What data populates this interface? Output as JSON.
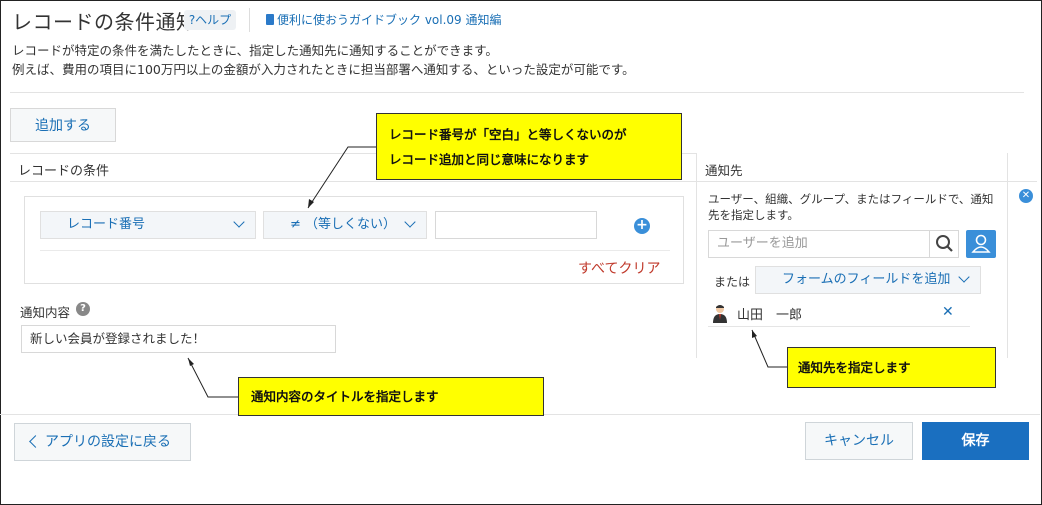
{
  "header": {
    "title": "レコードの条件通知",
    "help_label": "?ヘルプ",
    "guide_link": "便利に使おうガイドブック vol.09 通知編"
  },
  "description": {
    "line1": "レコードが特定の条件を満たしたときに、指定した通知先に通知することができます。",
    "line2": "例えば、費用の項目に100万円以上の金額が入力されたときに担当部署へ通知する、といった設定が可能です。"
  },
  "toolbar": {
    "add_label": "追加する"
  },
  "condition": {
    "header": "レコードの条件",
    "field_select": "レコード番号",
    "operator_select": "≠ （等しくない）",
    "value": "",
    "clear_all": "すべてクリア"
  },
  "notification": {
    "content_label": "通知内容",
    "content_value": "新しい会員が登録されました！"
  },
  "recipients": {
    "header": "通知先",
    "description": "ユーザー、組織、グループ、またはフィールドで、通知先を指定します。",
    "user_placeholder": "ユーザーを追加",
    "or_label": "または",
    "form_field_select": "フォームのフィールドを追加",
    "users": [
      "山田　一郎"
    ]
  },
  "footer": {
    "back_label": "アプリの設定に戻る",
    "cancel_label": "キャンセル",
    "save_label": "保存"
  },
  "callouts": {
    "condition_note_line1": "レコード番号が「空白」と等しくないのが",
    "condition_note_line2": "レコード追加と同じ意味になります",
    "content_note": "通知内容のタイトルを指定します",
    "recipient_note": "通知先を指定します"
  },
  "colors": {
    "accent": "#1a6fb5",
    "save_button": "#1a6fc0",
    "clear_all": "#c0392b",
    "callout_bg": "#ffff00"
  }
}
